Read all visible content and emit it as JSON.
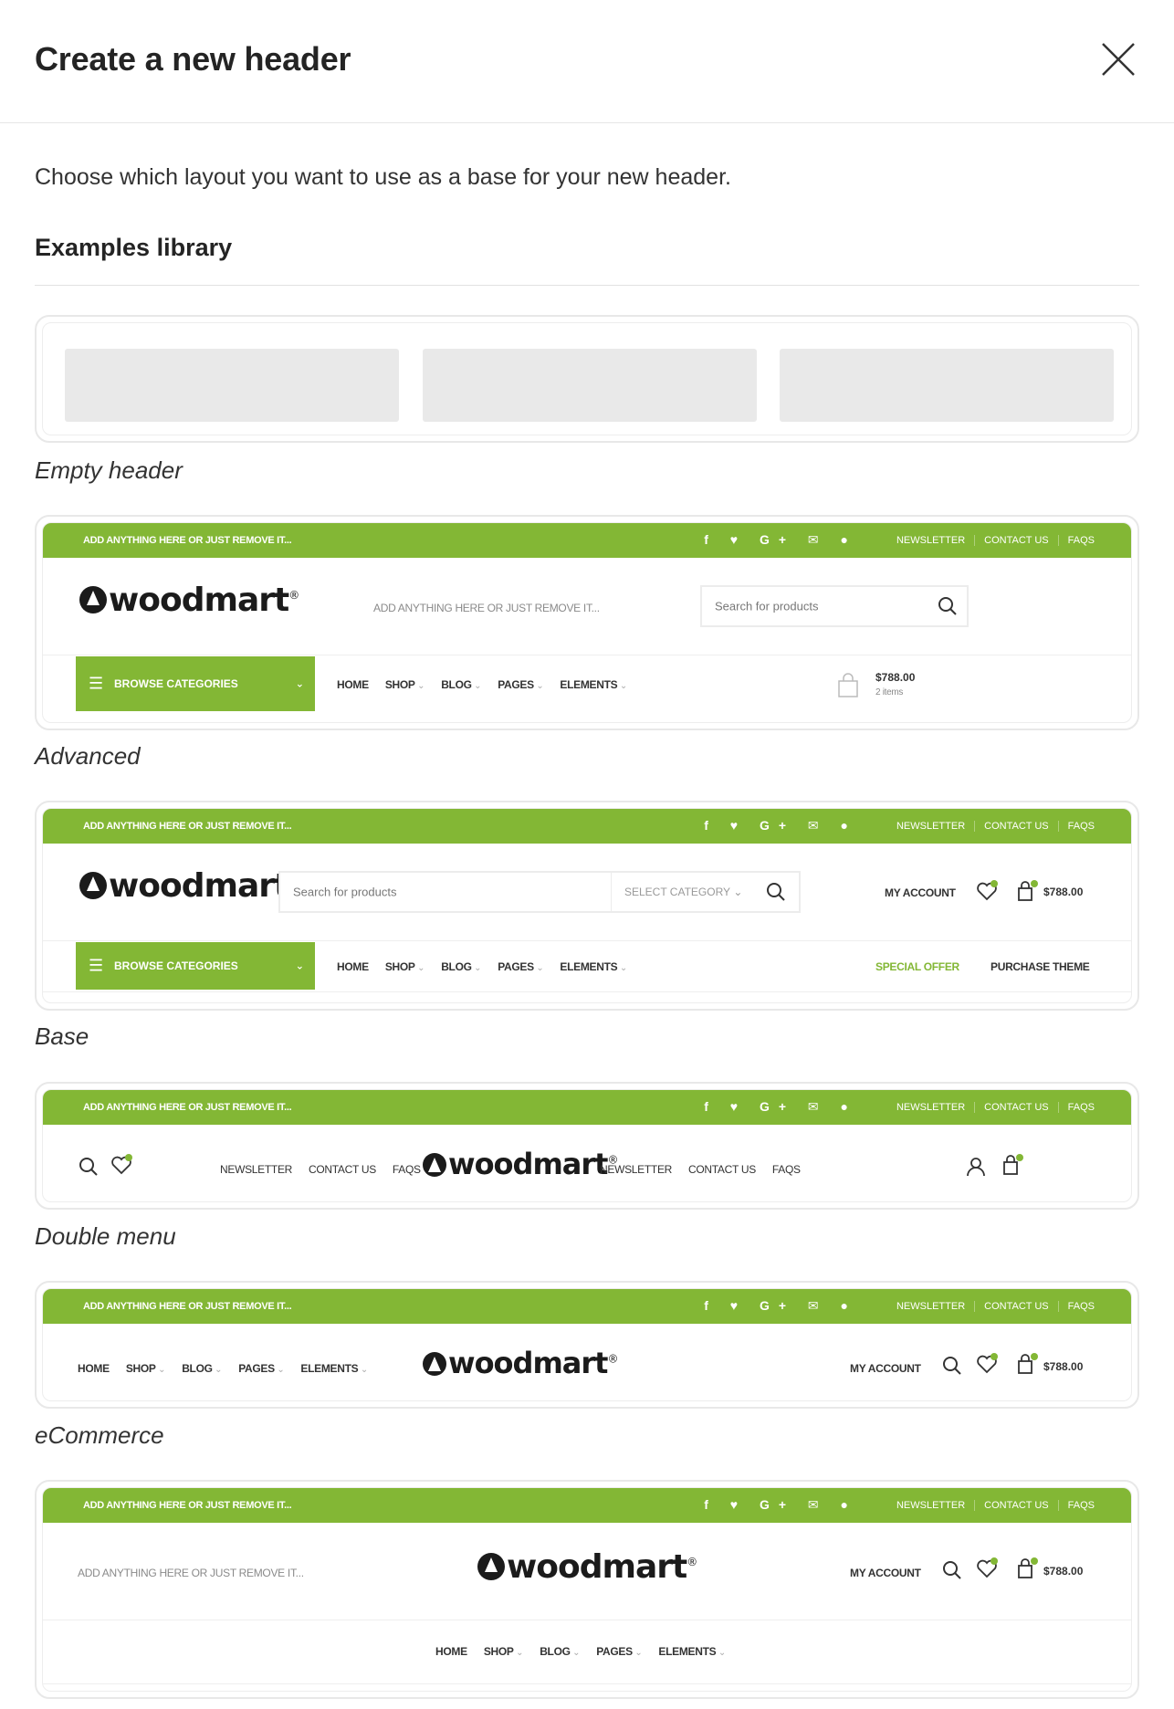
{
  "modal": {
    "title": "Create a new header",
    "intro": "Choose which layout you want to use as a base for your new header.",
    "library_title": "Examples library"
  },
  "colors": {
    "accent": "#83b735",
    "text": "#242424",
    "border": "#e8e8e8"
  },
  "common": {
    "promo": "ADD ANYTHING HERE OR JUST REMOVE IT...",
    "social": "f ♥ G+ ✉ ●",
    "top_links": [
      "NEWSLETTER",
      "CONTACT US",
      "FAQS"
    ],
    "logo": "woodmart",
    "logo_reg": "®",
    "search_placeholder": "Search for products",
    "select_category": "SELECT CATEGORY",
    "browse": "BROWSE CATEGORIES",
    "nav": [
      "HOME",
      "SHOP",
      "BLOG",
      "PAGES",
      "ELEMENTS"
    ],
    "my_account": "MY ACCOUNT",
    "price": "$788.00",
    "items": "2 items",
    "special_offer": "SPECIAL OFFER",
    "purchase_theme": "PURCHASE THEME",
    "header_text": "ADD ANYTHING HERE OR JUST REMOVE IT...",
    "wishlist_count": "0",
    "cart_count": "0"
  },
  "examples": [
    {
      "label": "Empty header"
    },
    {
      "label": "Advanced"
    },
    {
      "label": "Base"
    },
    {
      "label": "Double menu"
    },
    {
      "label": "eCommerce"
    }
  ]
}
